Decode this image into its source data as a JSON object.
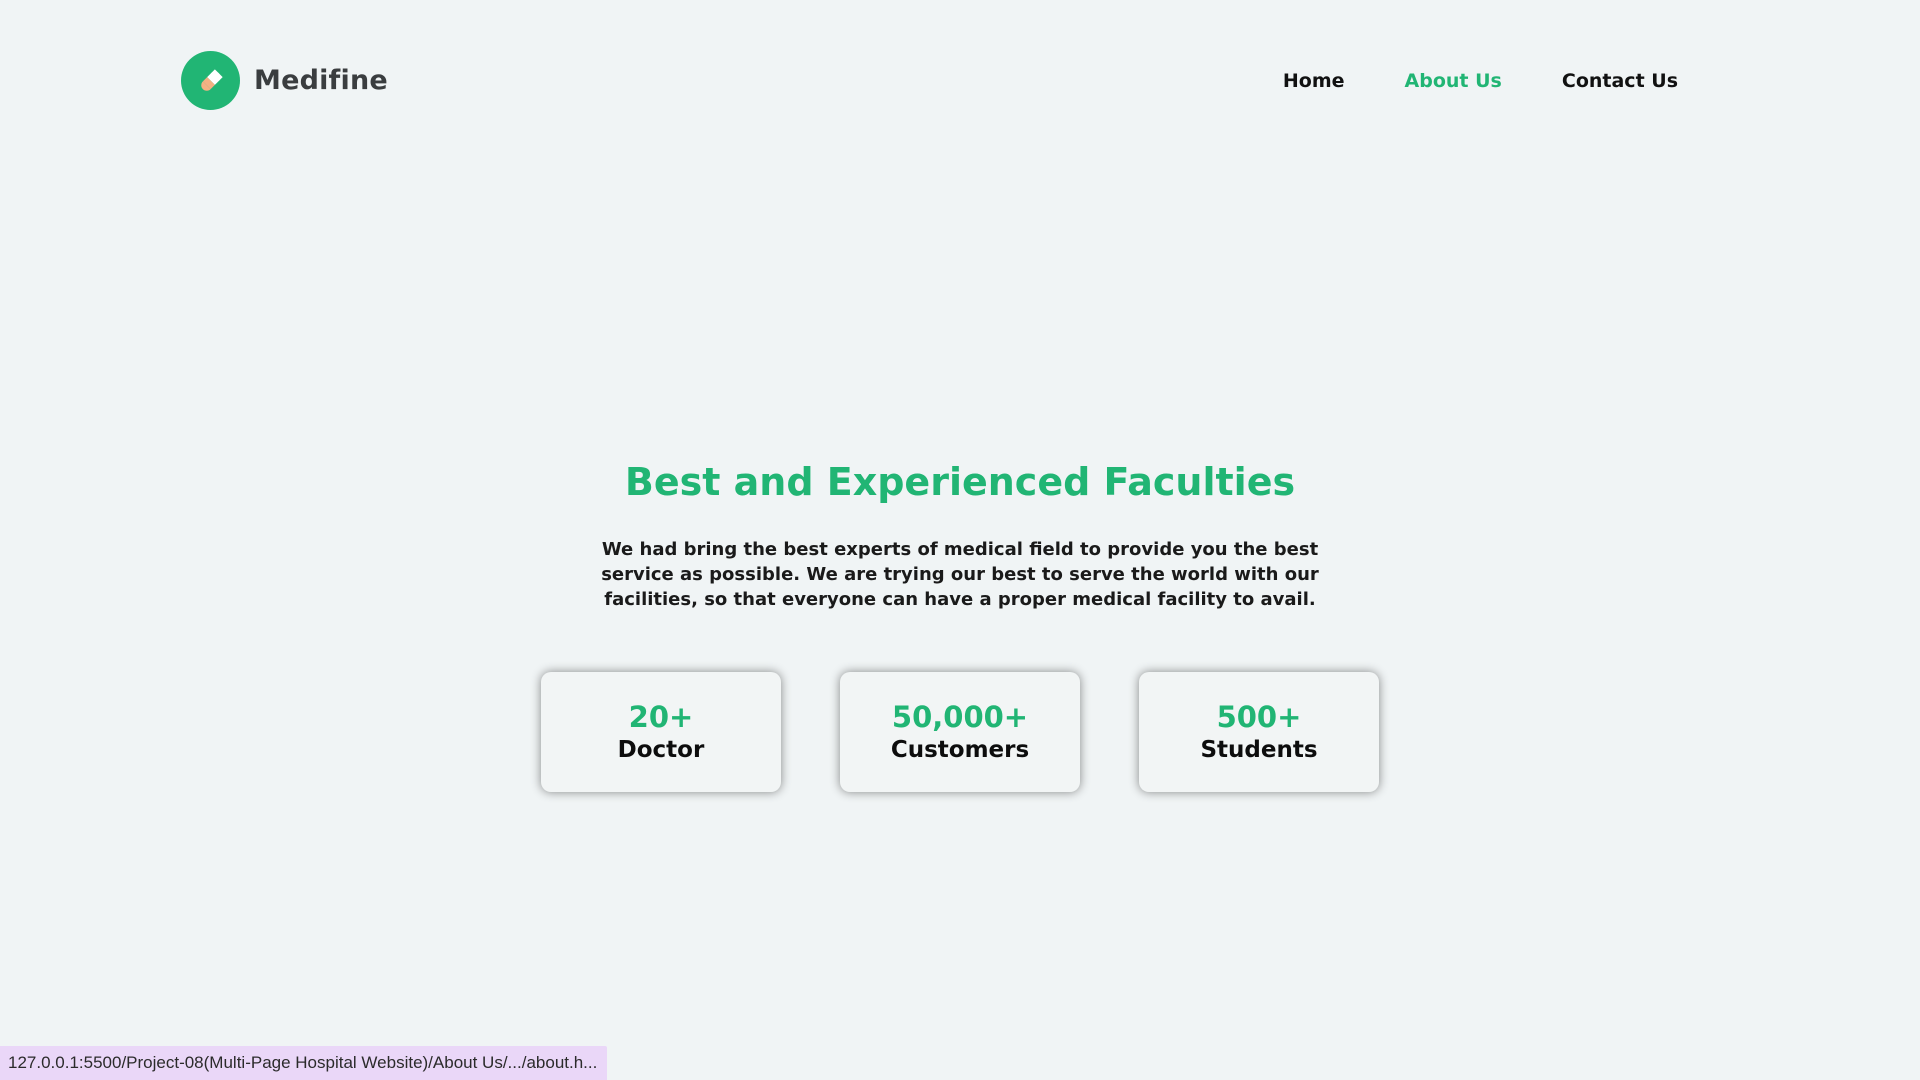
{
  "brand": {
    "name": "Medifine",
    "logo_icon": "pill-icon",
    "accent_color": "#21b574"
  },
  "nav": {
    "items": [
      {
        "label": "Home",
        "active": false
      },
      {
        "label": "About Us",
        "active": true
      },
      {
        "label": "Contact Us",
        "active": false
      }
    ]
  },
  "main": {
    "title": "Best and Experienced Faculties",
    "description": "We had bring the best experts of medical field to provide you the best service as possible. We are trying our best to serve the world with our facilities, so that everyone can have a proper medical facility to avail.",
    "stats": [
      {
        "value": "20+",
        "label": "Doctor"
      },
      {
        "value": "50,000+",
        "label": "Customers"
      },
      {
        "value": "500+",
        "label": "Students"
      }
    ]
  },
  "statusbar": {
    "url": "127.0.0.1:5500/Project-08(Multi-Page Hospital Website)/About Us/.../about.h..."
  }
}
